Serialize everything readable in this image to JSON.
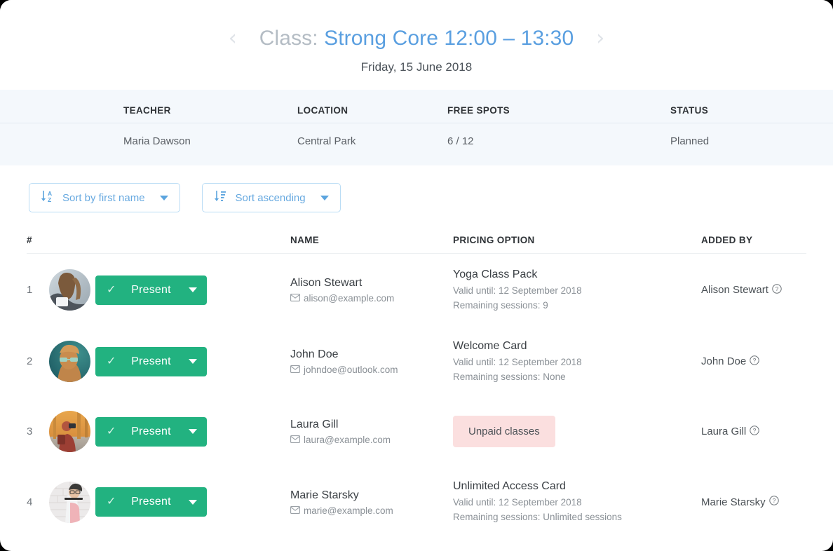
{
  "header": {
    "prev_icon": "chevron-left-icon",
    "next_icon": "chevron-right-icon",
    "title_prefix": "Class:",
    "title_main": "Strong Core 12:00 – 13:30",
    "subtitle": "Friday, 15 June 2018"
  },
  "info": {
    "headers": [
      "TEACHER",
      "LOCATION",
      "FREE SPOTS",
      "STATUS"
    ],
    "teacher": "Maria Dawson",
    "location": "Central Park",
    "free_spots": "6 / 12",
    "status": "Planned"
  },
  "sort": {
    "by_name": {
      "label": "Sort by first name",
      "icon": "sort-alpha-icon"
    },
    "direction": {
      "label": "Sort ascending",
      "icon": "sort-amount-icon"
    }
  },
  "table": {
    "headers": {
      "num": "#",
      "name": "NAME",
      "pricing": "PRICING OPTION",
      "added_by": "ADDED BY"
    },
    "rows": [
      {
        "num": "1",
        "attendance": "Present",
        "name": "Alison Stewart",
        "email": "alison@example.com",
        "pricing_title": "Yoga Class Pack",
        "valid_until": "Valid until: 12 September 2018",
        "remaining": "Remaining sessions: 9",
        "unpaid": null,
        "added_by": "Alison Stewart"
      },
      {
        "num": "2",
        "attendance": "Present",
        "name": "John Doe",
        "email": "johndoe@outlook.com",
        "pricing_title": "Welcome Card",
        "valid_until": "Valid until: 12 September 2018",
        "remaining": "Remaining sessions: None",
        "unpaid": null,
        "added_by": "John Doe"
      },
      {
        "num": "3",
        "attendance": "Present",
        "name": "Laura Gill",
        "email": "laura@example.com",
        "pricing_title": null,
        "valid_until": null,
        "remaining": null,
        "unpaid": "Unpaid classes",
        "added_by": "Laura Gill"
      },
      {
        "num": "4",
        "attendance": "Present",
        "name": "Marie Starsky",
        "email": "marie@example.com",
        "pricing_title": "Unlimited Access Card",
        "valid_until": "Valid until: 12 September 2018",
        "remaining": "Remaining sessions: Unlimited sessions",
        "unpaid": null,
        "added_by": "Marie Starsky"
      }
    ]
  },
  "colors": {
    "accent_blue": "#5a9fe0",
    "present_green": "#22b280",
    "unpaid_pink": "#fbdfdf",
    "band_bg": "#f4f8fc"
  }
}
